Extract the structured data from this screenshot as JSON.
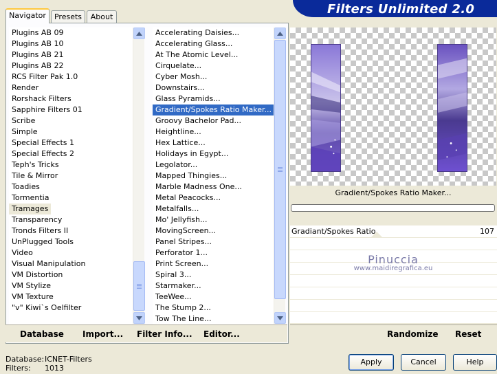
{
  "tabs": [
    "Navigator",
    "Presets",
    "About"
  ],
  "header": {
    "title": "Filters Unlimited 2.0"
  },
  "categories": {
    "items": [
      "Plugins AB 09",
      "Plugins AB 10",
      "Plugins AB 21",
      "Plugins AB 22",
      "RCS Filter Pak 1.0",
      "Render",
      "Rorshack Filters",
      "Sapphire Filters 01",
      "Scribe",
      "Simple",
      "Special Effects 1",
      "Special Effects 2",
      "Teph's Tricks",
      "Tile & Mirror",
      "Toadies",
      "Tormentia",
      "Tramages",
      "Transparency",
      "Tronds Filters II",
      "UnPlugged Tools",
      "Video",
      "Visual Manipulation",
      "VM Distortion",
      "VM Stylize",
      "VM Texture",
      "\"v\" Kiwi`s Oelfilter"
    ],
    "highlighted": 16
  },
  "filters": {
    "items": [
      "Accelerating Daisies...",
      "Accelerating Glass...",
      "At The Atomic Level...",
      "Cirquelate...",
      "Cyber Mosh...",
      "Downstairs...",
      "Glass Pyramids...",
      "Gradient/Spokes Ratio Maker...",
      "Groovy Bachelor Pad...",
      "Heightline...",
      "Hex Lattice...",
      "Holidays in Egypt...",
      "Legolator...",
      "Mapped Thingies...",
      "Marble Madness One...",
      "Metal Peacocks...",
      "Metalfalls...",
      "Mo' Jellyfish...",
      "MovingScreen...",
      "Panel Stripes...",
      "Perforator 1...",
      "Print Screen...",
      "Spiral 3...",
      "Starmaker...",
      "TeeWee...",
      "The Stump 2...",
      "Tow The Line..."
    ],
    "selected": 7
  },
  "bottom_buttons": {
    "database": "Database",
    "import": "Import...",
    "filter_info": "Filter Info...",
    "editor": "Editor..."
  },
  "preview": {
    "filter_name": "Gradient/Spokes Ratio Maker..."
  },
  "param": {
    "label": "Gradiant/Spokes Ratio",
    "value": "107"
  },
  "watermark": {
    "line1": "Pinuccia",
    "line2": "www.maidiregrafica.eu"
  },
  "right_buttons": {
    "randomize": "Randomize",
    "reset": "Reset"
  },
  "status": {
    "database_label": "Database:",
    "database_value": "ICNET-Filters",
    "filters_label": "Filters:",
    "filters_value": "1013"
  },
  "dialog_buttons": {
    "apply": "Apply",
    "cancel": "Cancel",
    "help": "Help"
  },
  "colors": {
    "header_blue": "#0a2a9a",
    "selection": "#316ac5",
    "scroll_button": "#c1d3fb",
    "strip_purple": "#6a52c0"
  },
  "icons": {
    "scroll_up": "triangle-up",
    "scroll_down": "triangle-down"
  }
}
